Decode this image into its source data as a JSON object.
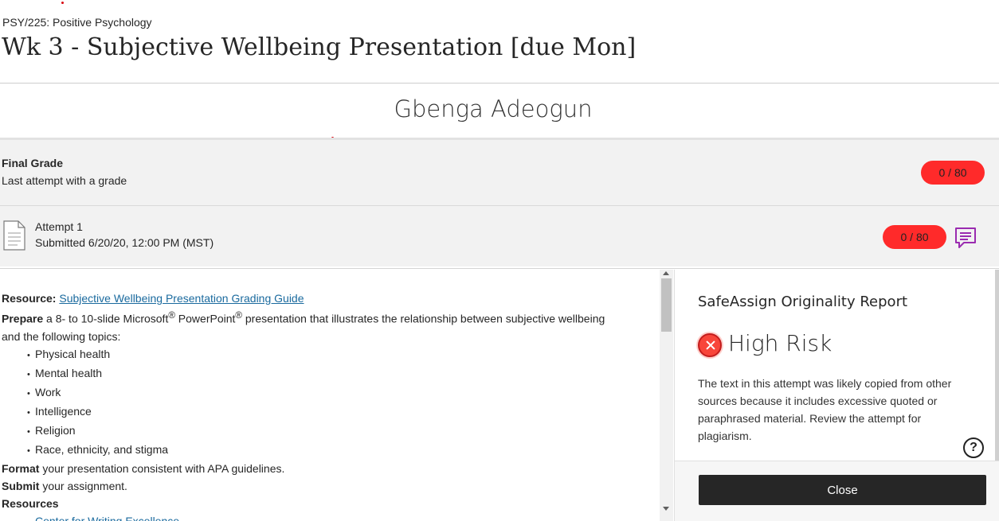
{
  "header": {
    "course": "PSY/225: Positive Psychology",
    "title": "Wk 3 - Subjective Wellbeing Presentation [due Mon]"
  },
  "student": {
    "name": "Gbenga Adeogun"
  },
  "final_grade": {
    "label": "Final Grade",
    "sublabel": "Last attempt with a grade",
    "score": "0 / 80"
  },
  "attempt": {
    "label": "Attempt 1",
    "submitted": "Submitted 6/20/20, 12:00 PM (MST)",
    "score": "0 / 80",
    "feedback_icon": "feedback-comment-icon",
    "document_icon": "document-icon"
  },
  "instructions": {
    "resource_label": "Resource:",
    "resource_link": "Subjective Wellbeing Presentation Grading Guide",
    "prepare_label": "Prepare",
    "prepare_text_1": " a 8- to 10-slide Microsoft",
    "prepare_sup_1": "®",
    "prepare_text_2": " PowerPoint",
    "prepare_sup_2": "®",
    "prepare_text_3": " presentation that illustrates the relationship between subjective wellbeing and the following topics:",
    "topics": [
      "Physical health",
      "Mental health",
      "Work",
      "Intelligence",
      "Religion",
      "Race, ethnicity, and stigma"
    ],
    "format_label": "Format",
    "format_text": " your presentation consistent with APA guidelines.",
    "submit_label": "Submit",
    "submit_text": " your assignment.",
    "resources_label": "Resources",
    "resources_links": [
      "Center for Writing Excellence"
    ]
  },
  "safeassign": {
    "heading": "SafeAssign Originality Report",
    "risk_label": "High Risk",
    "description": "The text in this attempt was likely copied from other sources because it includes excessive quoted or paraphrased material. Review the attempt for plagiarism.",
    "close_label": "Close",
    "help_glyph": "?"
  },
  "colors": {
    "grade_pill": "#ff2a2a",
    "feedback_icon": "#9a2bb0",
    "link": "#1a6a9e",
    "risk": "#f8453a"
  }
}
